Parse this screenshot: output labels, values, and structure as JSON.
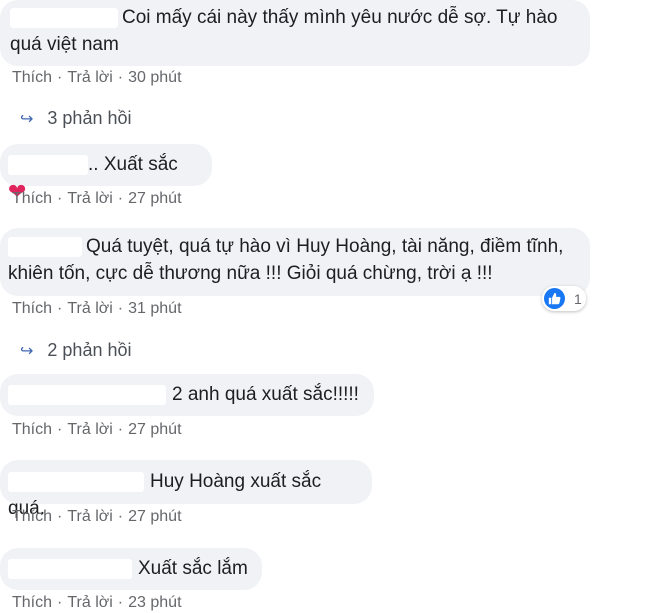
{
  "comments": [
    {
      "text_line1": "Coi mấy cái này thấy mình yêu nước dễ sợ. Tự hào",
      "text_line2": "quá việt nam",
      "like": "Thích",
      "reply": "Trả lời",
      "time": "30 phút",
      "replies": "3 phản hồi"
    },
    {
      "text": ".. Xuất sắc",
      "heart": "❤",
      "like": "Thích",
      "reply": "Trả lời",
      "time": "27 phút"
    },
    {
      "text_line1": "Quá tuyệt, quá tự hào vì Huy Hoàng, tài năng, điềm tĩnh,",
      "text_line2": "khiên tốn, cực dễ thương nữa !!! Giỏi quá chừng, trời ạ !!!",
      "like": "Thích",
      "reply": "Trả lời",
      "time": "31 phút",
      "reaction_count": "1",
      "replies": "2 phản hồi"
    },
    {
      "text": "2 anh quá xuất sắc!!!!!",
      "like": "Thích",
      "reply": "Trả lời",
      "time": "27 phút"
    },
    {
      "text": "Huy Hoàng xuất sắc quá.",
      "like": "Thích",
      "reply": "Trả lời",
      "time": "27 phút"
    },
    {
      "text": "Xuất sắc lắm",
      "like": "Thích",
      "reply": "Trả lời",
      "time": "23 phút"
    }
  ],
  "separator": "·",
  "colors": {
    "bubble": "#f0f2f5",
    "meta": "#65676b",
    "link": "#4267b2",
    "like": "#1877f2",
    "heart": "#e0245e"
  }
}
